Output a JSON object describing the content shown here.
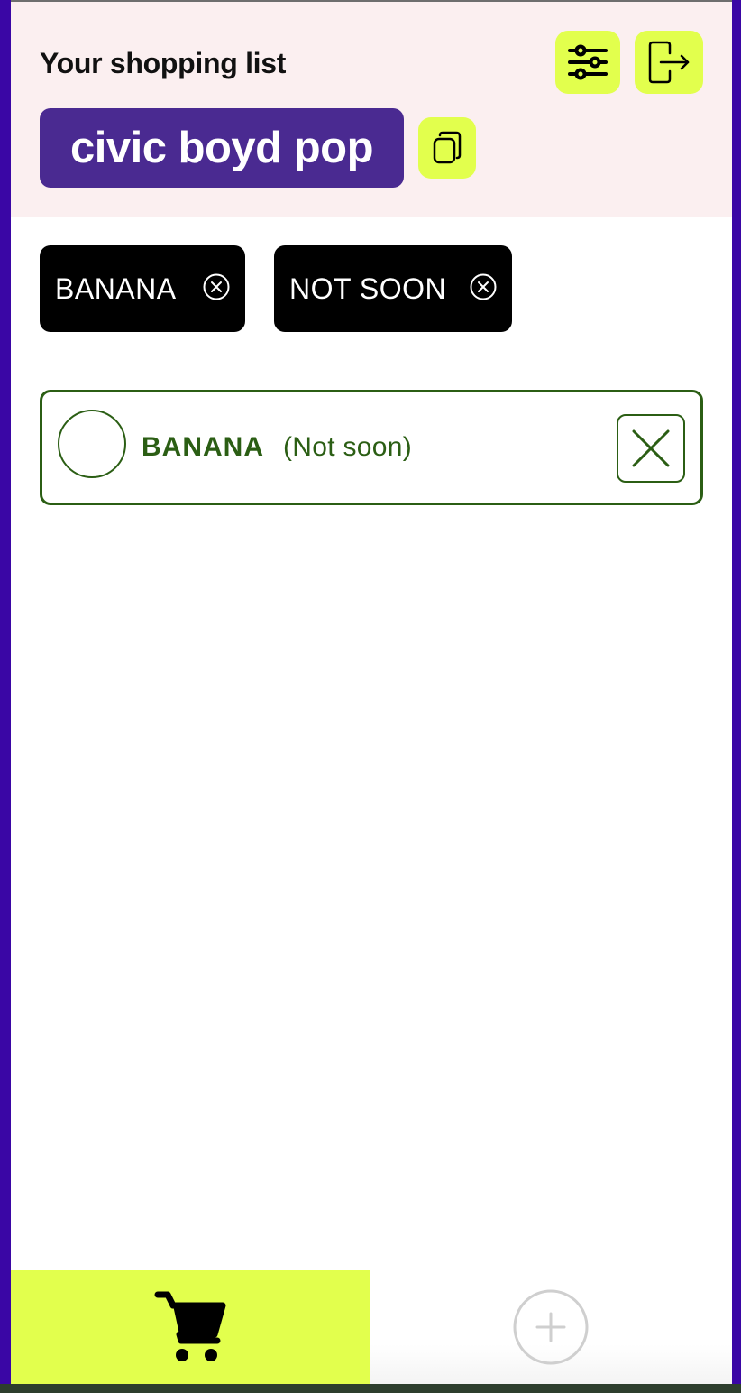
{
  "header": {
    "title": "Your shopping list",
    "list_token": "civic boyd pop"
  },
  "filters": {
    "chips": [
      {
        "label": "BANANA"
      },
      {
        "label": "NOT SOON"
      }
    ]
  },
  "items": [
    {
      "name": "BANANA",
      "urgency": "(Not soon)",
      "checked": false
    }
  ],
  "icons": {
    "settings": "sliders-icon",
    "logout": "logout-icon",
    "copy": "copy-icon",
    "chip_close": "circle-x-icon",
    "delete": "x-icon",
    "nav_list": "cart-icon",
    "nav_add": "plus-circle-icon"
  },
  "colors": {
    "frame": "#3a06a5",
    "header_bg": "#fbeff0",
    "accent": "#e2ff4d",
    "token_bg": "#4a2a91",
    "item_green": "#2b5e14",
    "chip_bg": "#000000"
  }
}
